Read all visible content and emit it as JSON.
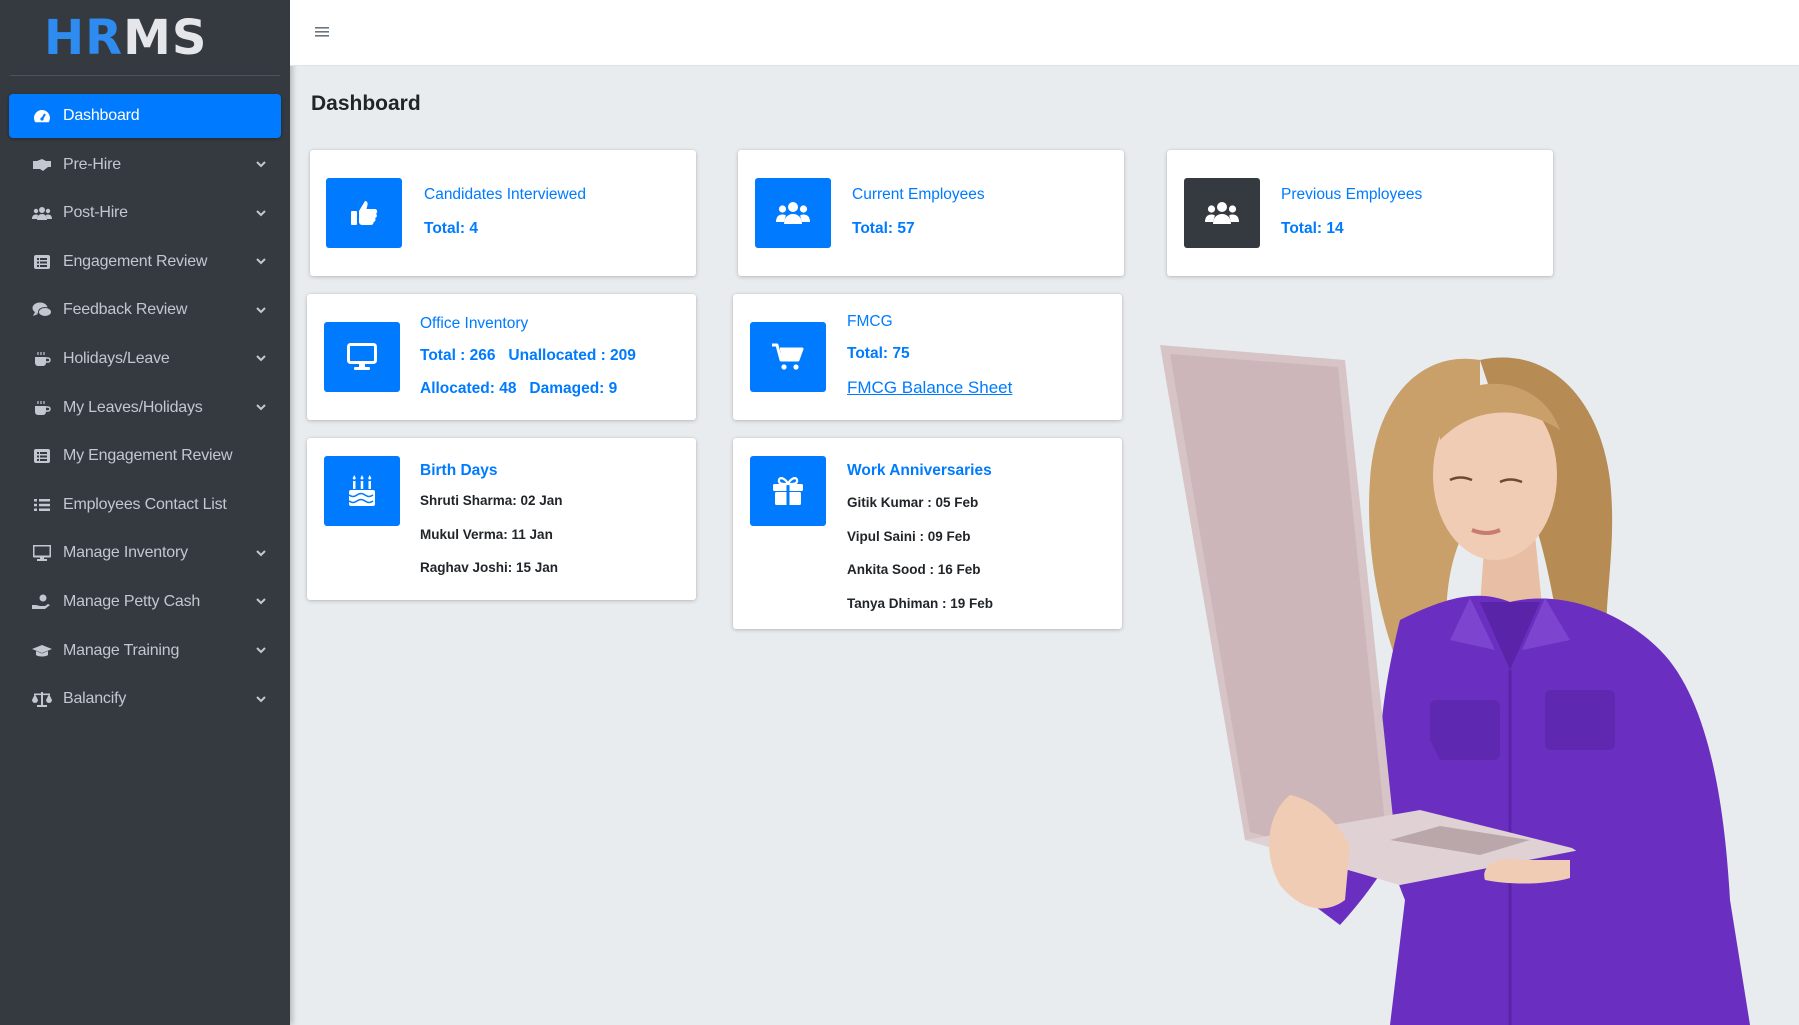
{
  "brand": {
    "part1": "HR",
    "part2": "MS"
  },
  "sidebar": {
    "items": [
      {
        "label": "Dashboard",
        "icon": "gauge-icon",
        "active": true,
        "expandable": false
      },
      {
        "label": "Pre-Hire",
        "icon": "handshake-icon",
        "expandable": true
      },
      {
        "label": "Post-Hire",
        "icon": "users-icon",
        "expandable": true
      },
      {
        "label": "Engagement Review",
        "icon": "list-icon",
        "expandable": true
      },
      {
        "label": "Feedback Review",
        "icon": "comments-icon",
        "expandable": true
      },
      {
        "label": "Holidays/Leave",
        "icon": "mug-icon",
        "expandable": true
      },
      {
        "label": "My Leaves/Holidays",
        "icon": "mug-icon",
        "expandable": true
      },
      {
        "label": "My Engagement Review",
        "icon": "list-icon",
        "expandable": false
      },
      {
        "label": "Employees Contact List",
        "icon": "bullet-list-icon",
        "expandable": false
      },
      {
        "label": "Manage Inventory",
        "icon": "desktop-icon",
        "expandable": true
      },
      {
        "label": "Manage Petty Cash",
        "icon": "hand-coin-icon",
        "expandable": true
      },
      {
        "label": "Manage Training",
        "icon": "graduation-cap-icon",
        "expandable": true
      },
      {
        "label": "Balancify",
        "icon": "balance-scale-icon",
        "expandable": true
      }
    ]
  },
  "topbar": {
    "menu_icon": "hamburger-icon"
  },
  "page": {
    "title": "Dashboard"
  },
  "cards": {
    "candidates": {
      "title": "Candidates Interviewed",
      "total": "Total: 4",
      "icon": "thumbs-up-icon"
    },
    "current": {
      "title": "Current Employees",
      "total": "Total: 57",
      "icon": "users-icon"
    },
    "previous": {
      "title": "Previous Employees",
      "total": "Total: 14",
      "icon": "users-icon"
    },
    "inventory": {
      "title": "Office Inventory",
      "line1": "Total : 266   Unallocated : 209",
      "line2": "Allocated: 48   Damaged: 9",
      "icon": "desktop-icon"
    },
    "fmcg": {
      "title": "FMCG",
      "total": "Total: 75",
      "link": "FMCG Balance Sheet",
      "icon": "shopping-cart-icon"
    },
    "birthdays": {
      "title": "Birth Days",
      "entries": [
        "Shruti Sharma: 02 Jan",
        "Mukul Verma: 11 Jan",
        "Raghav Joshi: 15 Jan"
      ],
      "icon": "birthday-cake-icon"
    },
    "anniversaries": {
      "title": "Work Anniversaries",
      "entries": [
        "Gitik Kumar : 05 Feb",
        "Vipul Saini : 09 Feb",
        "Ankita Sood : 16 Feb",
        "Tanya Dhiman : 19 Feb"
      ],
      "icon": "gift-icon"
    }
  },
  "colors": {
    "primary": "#007bff",
    "sidebar": "#343a40",
    "background": "#e9ecef",
    "shirt": "#6a2fc0"
  }
}
